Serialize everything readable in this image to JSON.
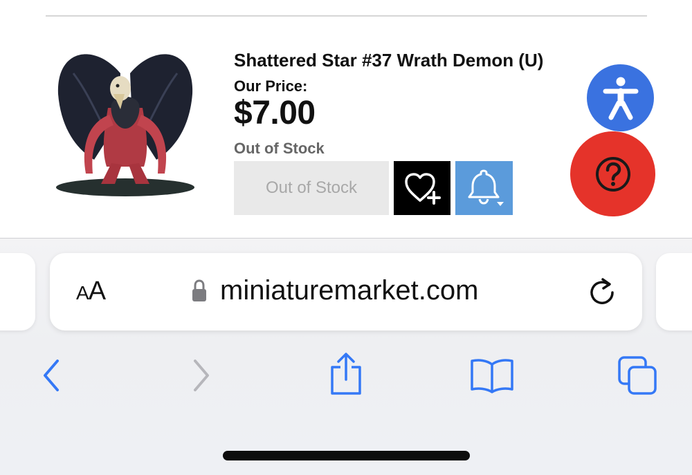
{
  "product": {
    "title": "Shattered Star #37 Wrath Demon (U)",
    "price_label": "Our Price:",
    "price": "$7.00",
    "stock_status": "Out of Stock",
    "button_label": "Out of Stock",
    "image_alt": "Wrath Demon miniature"
  },
  "browser": {
    "reader_label_small": "A",
    "reader_label_large": "A",
    "url": "miniaturemarket.com"
  },
  "icons": {
    "wishlist": "heart-plus-icon",
    "notify": "bell-icon",
    "accessibility": "accessibility-icon",
    "help": "question-icon",
    "back": "chevron-left-icon",
    "forward": "chevron-right-icon",
    "share": "share-icon",
    "bookmarks": "book-icon",
    "tabs": "tabs-icon",
    "lock": "lock-icon",
    "reload": "reload-icon"
  },
  "colors": {
    "accent_blue": "#3a72e0",
    "notify_blue": "#5b9bdb",
    "help_red": "#e5332a",
    "ios_blue": "#3478f6"
  }
}
